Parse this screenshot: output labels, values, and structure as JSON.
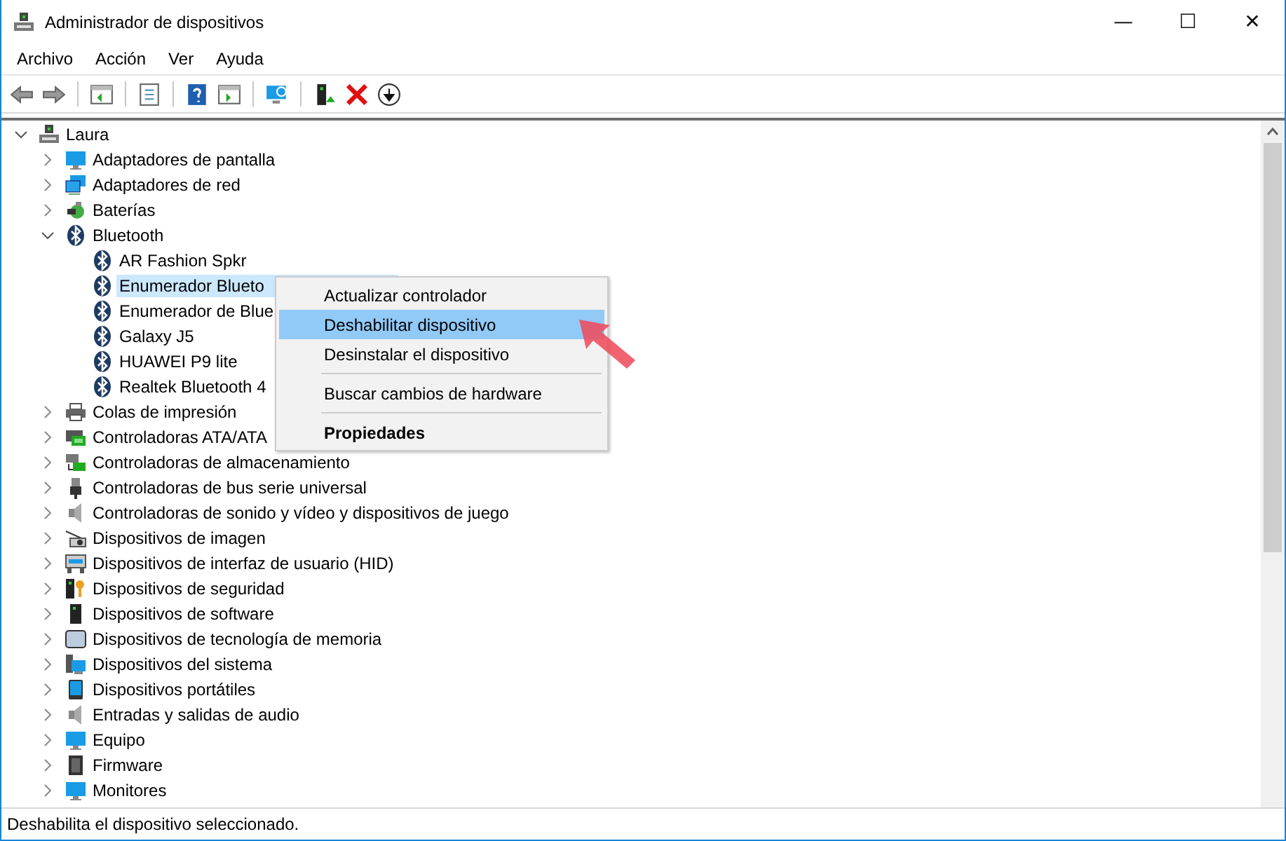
{
  "window": {
    "title": "Administrador de dispositivos",
    "controls": [
      "—",
      "☐",
      "✕"
    ]
  },
  "menu": [
    "Archivo",
    "Acción",
    "Ver",
    "Ayuda"
  ],
  "toolbar": [
    {
      "kind": "back"
    },
    {
      "kind": "forward"
    },
    {
      "kind": "sep"
    },
    {
      "kind": "tree"
    },
    {
      "kind": "sep"
    },
    {
      "kind": "properties"
    },
    {
      "kind": "sep"
    },
    {
      "kind": "help"
    },
    {
      "kind": "pane"
    },
    {
      "kind": "sep"
    },
    {
      "kind": "scan"
    },
    {
      "kind": "sep"
    },
    {
      "kind": "update"
    },
    {
      "kind": "remove"
    },
    {
      "kind": "disable"
    }
  ],
  "tree": {
    "label": "Laura",
    "kind": "computer",
    "expanded": true,
    "selected": false,
    "children": [
      {
        "label": "Adaptadores de pantalla",
        "kind": "display",
        "expanded": false,
        "selected": false
      },
      {
        "label": "Adaptadores de red",
        "kind": "network",
        "expanded": false,
        "selected": false
      },
      {
        "label": "Baterías",
        "kind": "battery",
        "expanded": false,
        "selected": false
      },
      {
        "label": "Bluetooth",
        "kind": "bluetooth",
        "expanded": true,
        "selected": false,
        "children": [
          {
            "label": "AR Fashion Spkr",
            "kind": "bluetooth",
            "selected": false
          },
          {
            "label": "Enumerador Blueto",
            "kind": "bluetooth",
            "selected": true
          },
          {
            "label": "Enumerador de Blue",
            "kind": "bluetooth",
            "selected": false
          },
          {
            "label": "Galaxy J5",
            "kind": "bluetooth",
            "selected": false
          },
          {
            "label": "HUAWEI P9 lite",
            "kind": "bluetooth",
            "selected": false
          },
          {
            "label": "Realtek Bluetooth 4",
            "kind": "bluetooth",
            "selected": false
          }
        ]
      },
      {
        "label": "Colas de impresión",
        "kind": "printer",
        "expanded": false,
        "selected": false
      },
      {
        "label": "Controladoras ATA/ATA",
        "kind": "board",
        "expanded": false,
        "selected": false
      },
      {
        "label": "Controladoras de almacenamiento",
        "kind": "storage",
        "expanded": false,
        "selected": false
      },
      {
        "label": "Controladoras de bus serie universal",
        "kind": "usb",
        "expanded": false,
        "selected": false
      },
      {
        "label": "Controladoras de sonido y vídeo y dispositivos de juego",
        "kind": "speaker",
        "expanded": false,
        "selected": false
      },
      {
        "label": "Dispositivos de imagen",
        "kind": "camera",
        "expanded": false,
        "selected": false
      },
      {
        "label": "Dispositivos de interfaz de usuario (HID)",
        "kind": "keyboard",
        "expanded": false,
        "selected": false
      },
      {
        "label": "Dispositivos de seguridad",
        "kind": "security",
        "expanded": false,
        "selected": false
      },
      {
        "label": "Dispositivos de software",
        "kind": "tower",
        "expanded": false,
        "selected": false
      },
      {
        "label": "Dispositivos de tecnología de memoria",
        "kind": "memory",
        "expanded": false,
        "selected": false
      },
      {
        "label": "Dispositivos del sistema",
        "kind": "system",
        "expanded": false,
        "selected": false
      },
      {
        "label": "Dispositivos portátiles",
        "kind": "portable",
        "expanded": false,
        "selected": false
      },
      {
        "label": "Entradas y salidas de audio",
        "kind": "speaker",
        "expanded": false,
        "selected": false
      },
      {
        "label": "Equipo",
        "kind": "display",
        "expanded": false,
        "selected": false
      },
      {
        "label": "Firmware",
        "kind": "chip",
        "expanded": false,
        "selected": false
      },
      {
        "label": "Monitores",
        "kind": "display",
        "expanded": false,
        "selected": false
      }
    ]
  },
  "context_menu": [
    {
      "label": "Actualizar controlador",
      "selected": false,
      "default": false,
      "separator_before": false
    },
    {
      "label": "Deshabilitar dispositivo",
      "selected": true,
      "default": false,
      "separator_before": false
    },
    {
      "label": "Desinstalar el dispositivo",
      "selected": false,
      "default": false,
      "separator_before": false
    },
    {
      "label": "Buscar cambios de hardware",
      "selected": false,
      "default": false,
      "separator_before": true
    },
    {
      "label": "Propiedades",
      "selected": false,
      "default": true,
      "separator_before": true
    }
  ],
  "status_bar": "Deshabilita el dispositivo seleccionado."
}
